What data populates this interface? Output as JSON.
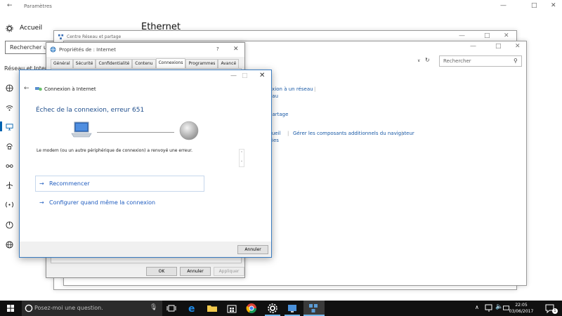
{
  "settings": {
    "window_title": "Paramètres",
    "home_label": "Accueil",
    "search_placeholder": "Rechercher un paramètre",
    "section_label": "Réseau et Internet",
    "page_title": "Ethernet"
  },
  "network_center": {
    "title": "Centre Réseau et partage"
  },
  "back_window": {
    "search_placeholder": "Rechercher",
    "links": [
      "exion à un réseau",
      "eau",
      "partage",
      "cueil",
      "Gérer les composants additionnels du navigateur",
      "kies"
    ]
  },
  "properties": {
    "title": "Propriétés de : Internet",
    "help": "?",
    "tabs": [
      "Général",
      "Sécurité",
      "Confidentialité",
      "Contenu",
      "Connexions",
      "Programmes",
      "Avancé"
    ],
    "active_tab": "Connexions",
    "ok_label": "OK",
    "cancel_label": "Annuler",
    "apply_label": "Appliquer"
  },
  "connect_dialog": {
    "title": "Connexion à Internet",
    "error_title": "Échec de la connexion, erreur 651",
    "message": "Le modem (ou un autre périphérique de connexion) a renvoyé une erreur.",
    "option_retry": "Recommencer",
    "option_setup": "Configurer quand même la connexion",
    "cancel_label": "Annuler"
  },
  "taskbar": {
    "search_placeholder": "Posez-moi une question.",
    "time": "22:05",
    "date": "03/06/2017",
    "notification_count": "1"
  }
}
